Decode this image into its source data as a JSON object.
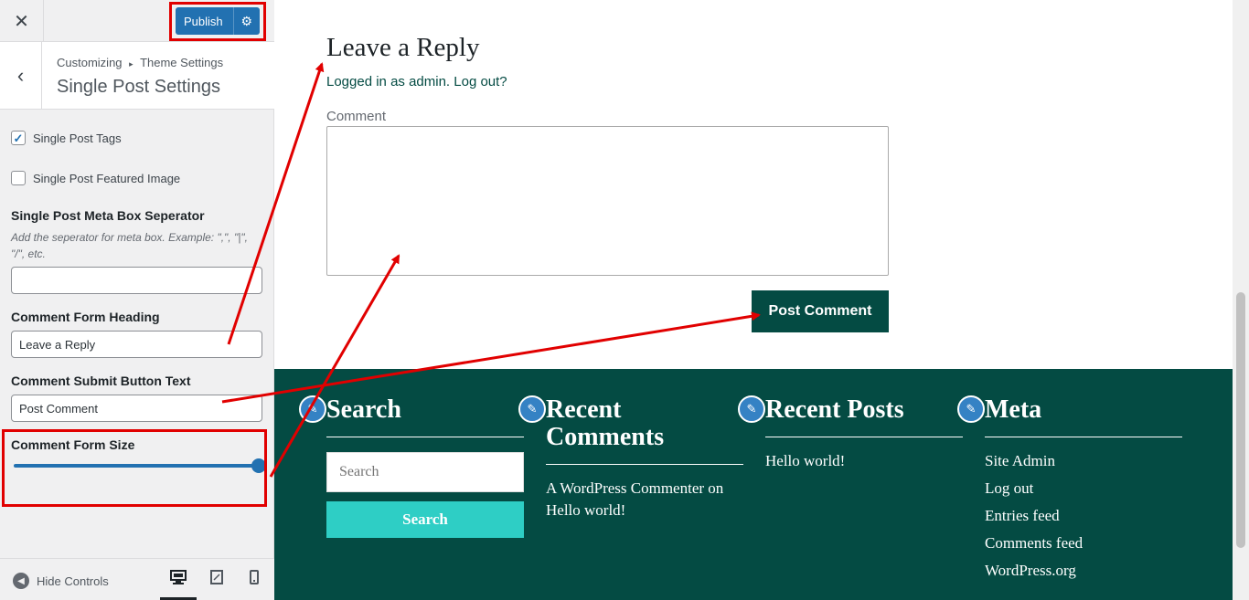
{
  "sidebar": {
    "close_icon": "close-icon",
    "publish_label": "Publish",
    "breadcrumb_root": "Customizing",
    "breadcrumb_sep": "▸",
    "breadcrumb_parent": "Theme Settings",
    "section_title": "Single Post Settings",
    "controls": {
      "tags_label": "Single Post Tags",
      "tags_checked": true,
      "featured_label": "Single Post Featured Image",
      "featured_checked": false,
      "separator_title": "Single Post Meta Box Seperator",
      "separator_desc": "Add the seperator for meta box. Example: \",\", \"|\", \"/\", etc.",
      "separator_value": "",
      "heading_title": "Comment Form Heading",
      "heading_value": "Leave a Reply",
      "submit_title": "Comment Submit Button Text",
      "submit_value": "Post Comment",
      "size_title": "Comment Form Size",
      "size_fraction": 1.0
    },
    "footer": {
      "hide_controls_label": "Hide Controls",
      "devices": [
        "desktop",
        "tablet",
        "mobile"
      ]
    }
  },
  "preview": {
    "reply_title": "Leave a Reply",
    "logged_in": "Logged in as admin. Log out?",
    "comment_label": "Comment",
    "post_comment": "Post Comment",
    "footer_widgets": {
      "search": {
        "title": "Search",
        "placeholder": "Search",
        "button": "Search"
      },
      "recent_comments": {
        "title": "Recent Comments",
        "items": [
          "A WordPress Commenter on Hello world!"
        ]
      },
      "recent_posts": {
        "title": "Recent Posts",
        "items": [
          "Hello world!"
        ]
      },
      "meta": {
        "title": "Meta",
        "items": [
          "Site Admin",
          "Log out",
          "Entries feed",
          "Comments feed",
          "WordPress.org"
        ]
      }
    }
  },
  "colors": {
    "accent": "#2271b1",
    "footer_bg": "#044b43",
    "search_button": "#2ecec5",
    "annotation": "#e10000"
  }
}
